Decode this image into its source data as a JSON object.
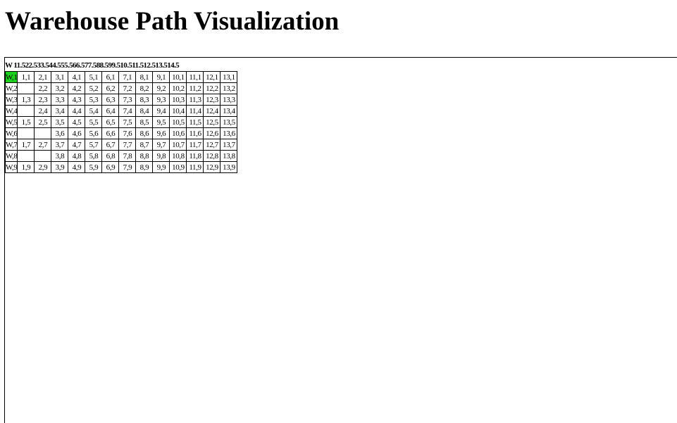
{
  "page": {
    "title": "Warehouse Path Visualization"
  },
  "header": {
    "labels": [
      "W",
      "1",
      "1.5",
      "2",
      "2.5",
      "3",
      "3.5",
      "4",
      "4.5",
      "5",
      "5.5",
      "6",
      "6.5",
      "7",
      "7.5",
      "8",
      "8.5",
      "9",
      "9.5",
      "10",
      "10.5",
      "11",
      "11.5",
      "12",
      "12.5",
      "13",
      "13.5",
      "14",
      "14.5"
    ],
    "text": "W  11.522.533.544.555.566.577.588.599.510.511.512.513.514.5"
  },
  "grid": {
    "start_color": "#1fd11f",
    "rows": [
      [
        "W,1",
        "1,1",
        "2,1",
        "3,1",
        "4,1",
        "5,1",
        "6,1",
        "7,1",
        "8,1",
        "9,1",
        "10,1",
        "11,1",
        "12,1",
        "13,1"
      ],
      [
        "W,2",
        "",
        "2,2",
        "3,2",
        "4,2",
        "5,2",
        "6,2",
        "7,2",
        "8,2",
        "9,2",
        "10,2",
        "11,2",
        "12,2",
        "13,2"
      ],
      [
        "W,3",
        "1,3",
        "2,3",
        "3,3",
        "4,3",
        "5,3",
        "6,3",
        "7,3",
        "8,3",
        "9,3",
        "10,3",
        "11,3",
        "12,3",
        "13,3"
      ],
      [
        "W,4",
        "",
        "2,4",
        "3,4",
        "4,4",
        "5,4",
        "6,4",
        "7,4",
        "8,4",
        "9,4",
        "10,4",
        "11,4",
        "12,4",
        "13,4"
      ],
      [
        "W,5",
        "1,5",
        "2,5",
        "3,5",
        "4,5",
        "5,5",
        "6,5",
        "7,5",
        "8,5",
        "9,5",
        "10,5",
        "11,5",
        "12,5",
        "13,5"
      ],
      [
        "W,6",
        "",
        "",
        "3,6",
        "4,6",
        "5,6",
        "6,6",
        "7,6",
        "8,6",
        "9,6",
        "10,6",
        "11,6",
        "12,6",
        "13,6"
      ],
      [
        "W,7",
        "1,7",
        "2,7",
        "3,7",
        "4,7",
        "5,7",
        "6,7",
        "7,7",
        "8,7",
        "9,7",
        "10,7",
        "11,7",
        "12,7",
        "13,7"
      ],
      [
        "W,8",
        "",
        "",
        "3,8",
        "4,8",
        "5,8",
        "6,8",
        "7,8",
        "8,8",
        "9,8",
        "10,8",
        "11,8",
        "12,8",
        "13,8"
      ],
      [
        "W,9",
        "1,9",
        "2,9",
        "3,9",
        "4,9",
        "5,9",
        "6,9",
        "7,9",
        "8,9",
        "9,9",
        "10,9",
        "11,9",
        "12,9",
        "13,9"
      ]
    ]
  }
}
